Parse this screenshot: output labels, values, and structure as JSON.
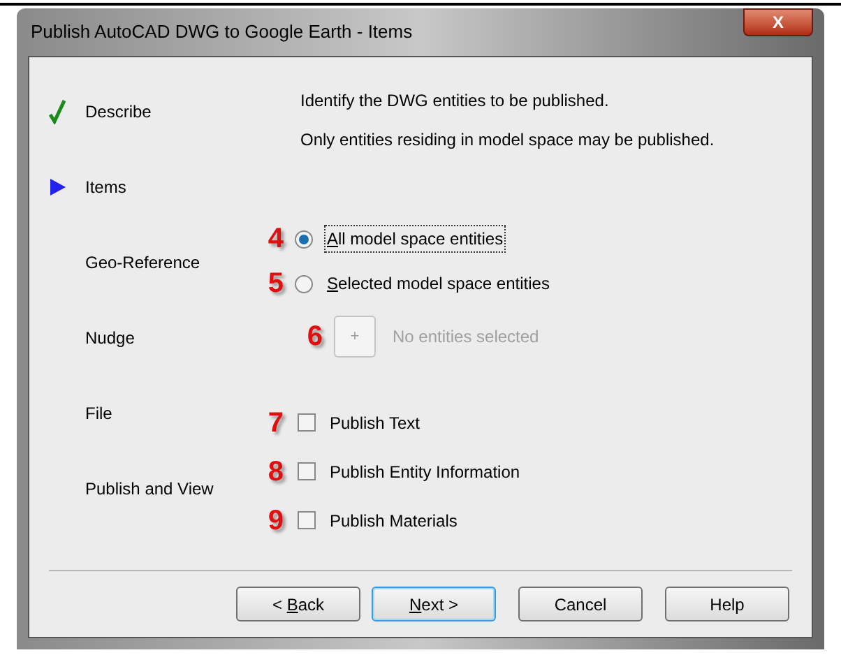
{
  "window": {
    "title": "Publish AutoCAD DWG to Google Earth - Items",
    "close": "X"
  },
  "steps": [
    {
      "label": "Describe",
      "kind": "done"
    },
    {
      "label": "Items",
      "kind": "current"
    },
    {
      "label": "Geo-Reference",
      "kind": "pending"
    },
    {
      "label": "Nudge",
      "kind": "pending"
    },
    {
      "label": "File",
      "kind": "pending"
    },
    {
      "label": "Publish and View",
      "kind": "pending"
    }
  ],
  "intro": [
    "Identify the DWG entities to be published.",
    "Only entities residing in model space may be published."
  ],
  "options": [
    {
      "kind": "radio",
      "callout": "4",
      "key": "A",
      "after": "ll model space entities",
      "selected": true,
      "focused": true
    },
    {
      "kind": "radio",
      "callout": "5",
      "key": "S",
      "after": "elected model space entities",
      "selected": false,
      "focused": false
    },
    {
      "kind": "picker",
      "callout": "6",
      "button": "+",
      "status": "No entities selected",
      "disabled": true
    },
    {
      "kind": "checkbox",
      "callout": "7",
      "label": "Publish Text",
      "checked": false
    },
    {
      "kind": "checkbox",
      "callout": "8",
      "label": "Publish Entity Information",
      "checked": false
    },
    {
      "kind": "checkbox",
      "callout": "9",
      "label": "Publish Materials",
      "checked": false
    }
  ],
  "buttons": [
    {
      "before": "< ",
      "key": "B",
      "after": "ack",
      "default": false
    },
    {
      "key": "N",
      "after": "ext >",
      "default": true
    },
    {
      "before": "Cancel",
      "default": false
    },
    {
      "before": "Help",
      "default": false
    }
  ]
}
